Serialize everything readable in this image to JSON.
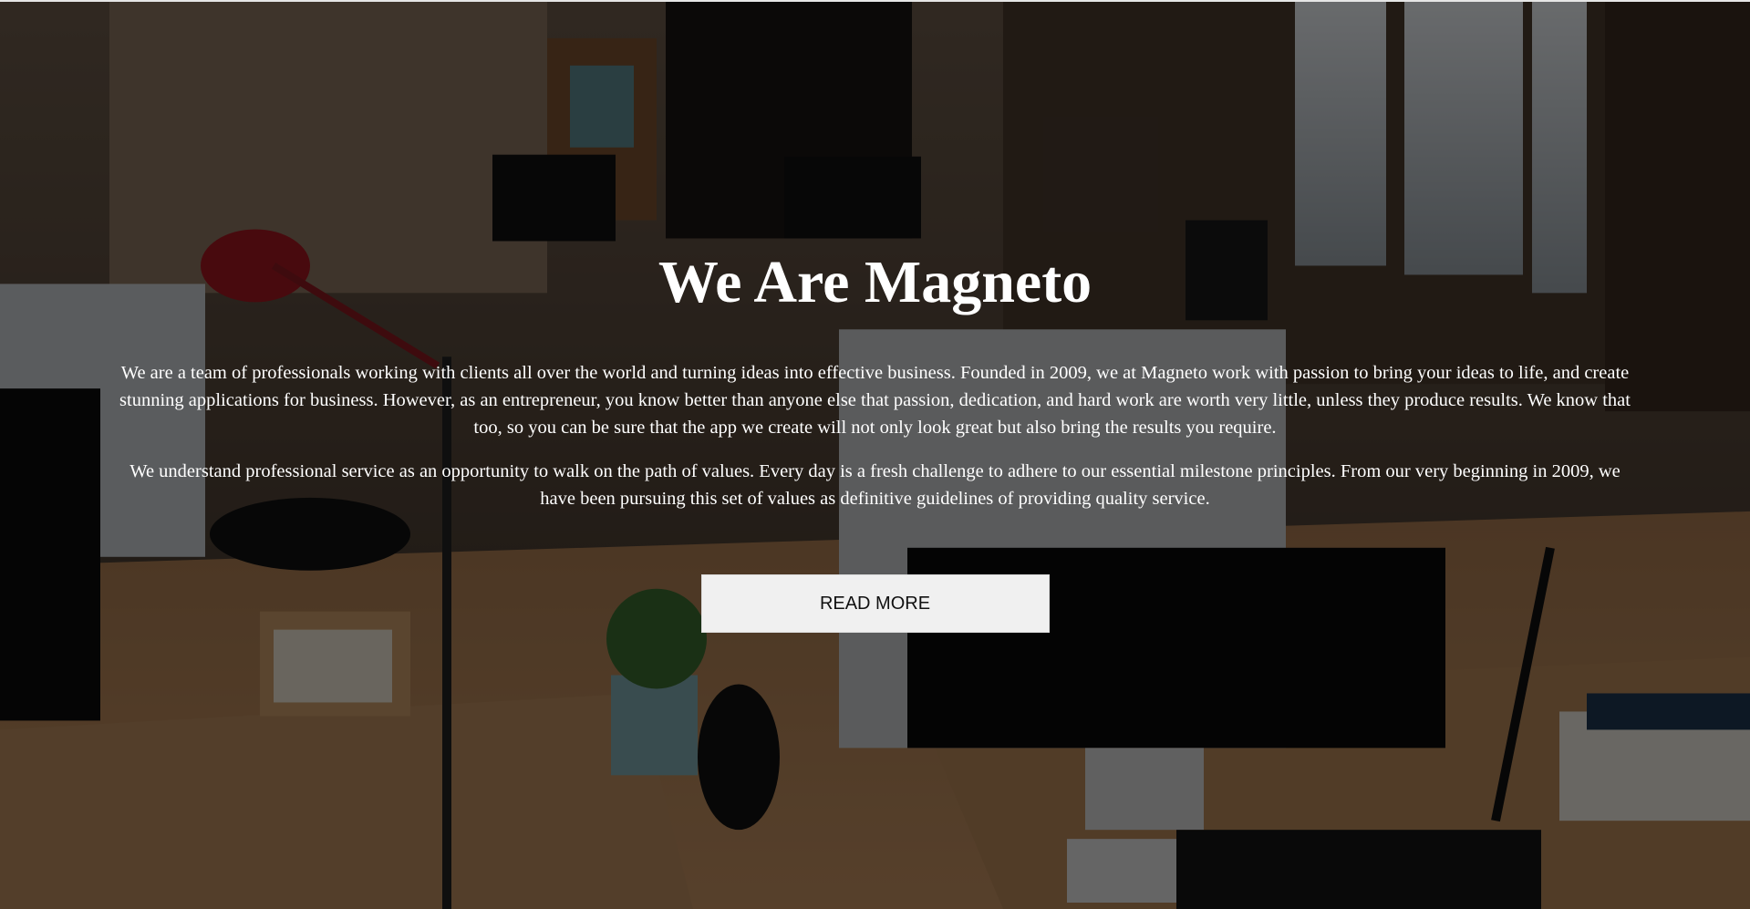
{
  "hero": {
    "title": "We Are Magneto",
    "paragraphs": [
      "We are a team of professionals working with clients all over the world and turning ideas into effective business. Founded in 2009, we at Magneto work with passion to bring your ideas to life, and create stunning applications for business. However, as an entrepreneur, you know better than anyone else that passion, dedication, and hard work are worth very little, unless they produce results. We know that too, so you can be sure that the app we create will not only look great but also bring the results you require.",
      "We understand professional service as an opportunity to walk on the path of values. Every day is a fresh challenge to adhere to our essential milestone principles. From our very beginning in 2009, we have been pursuing this set of values as definitive guidelines of providing quality service."
    ],
    "button_label": "READ MORE",
    "background_image": "office-workspace-photo"
  },
  "colors": {
    "overlay": "#000000",
    "text": "#ffffff",
    "button_bg": "#f0f0f0",
    "button_text": "#111111"
  }
}
